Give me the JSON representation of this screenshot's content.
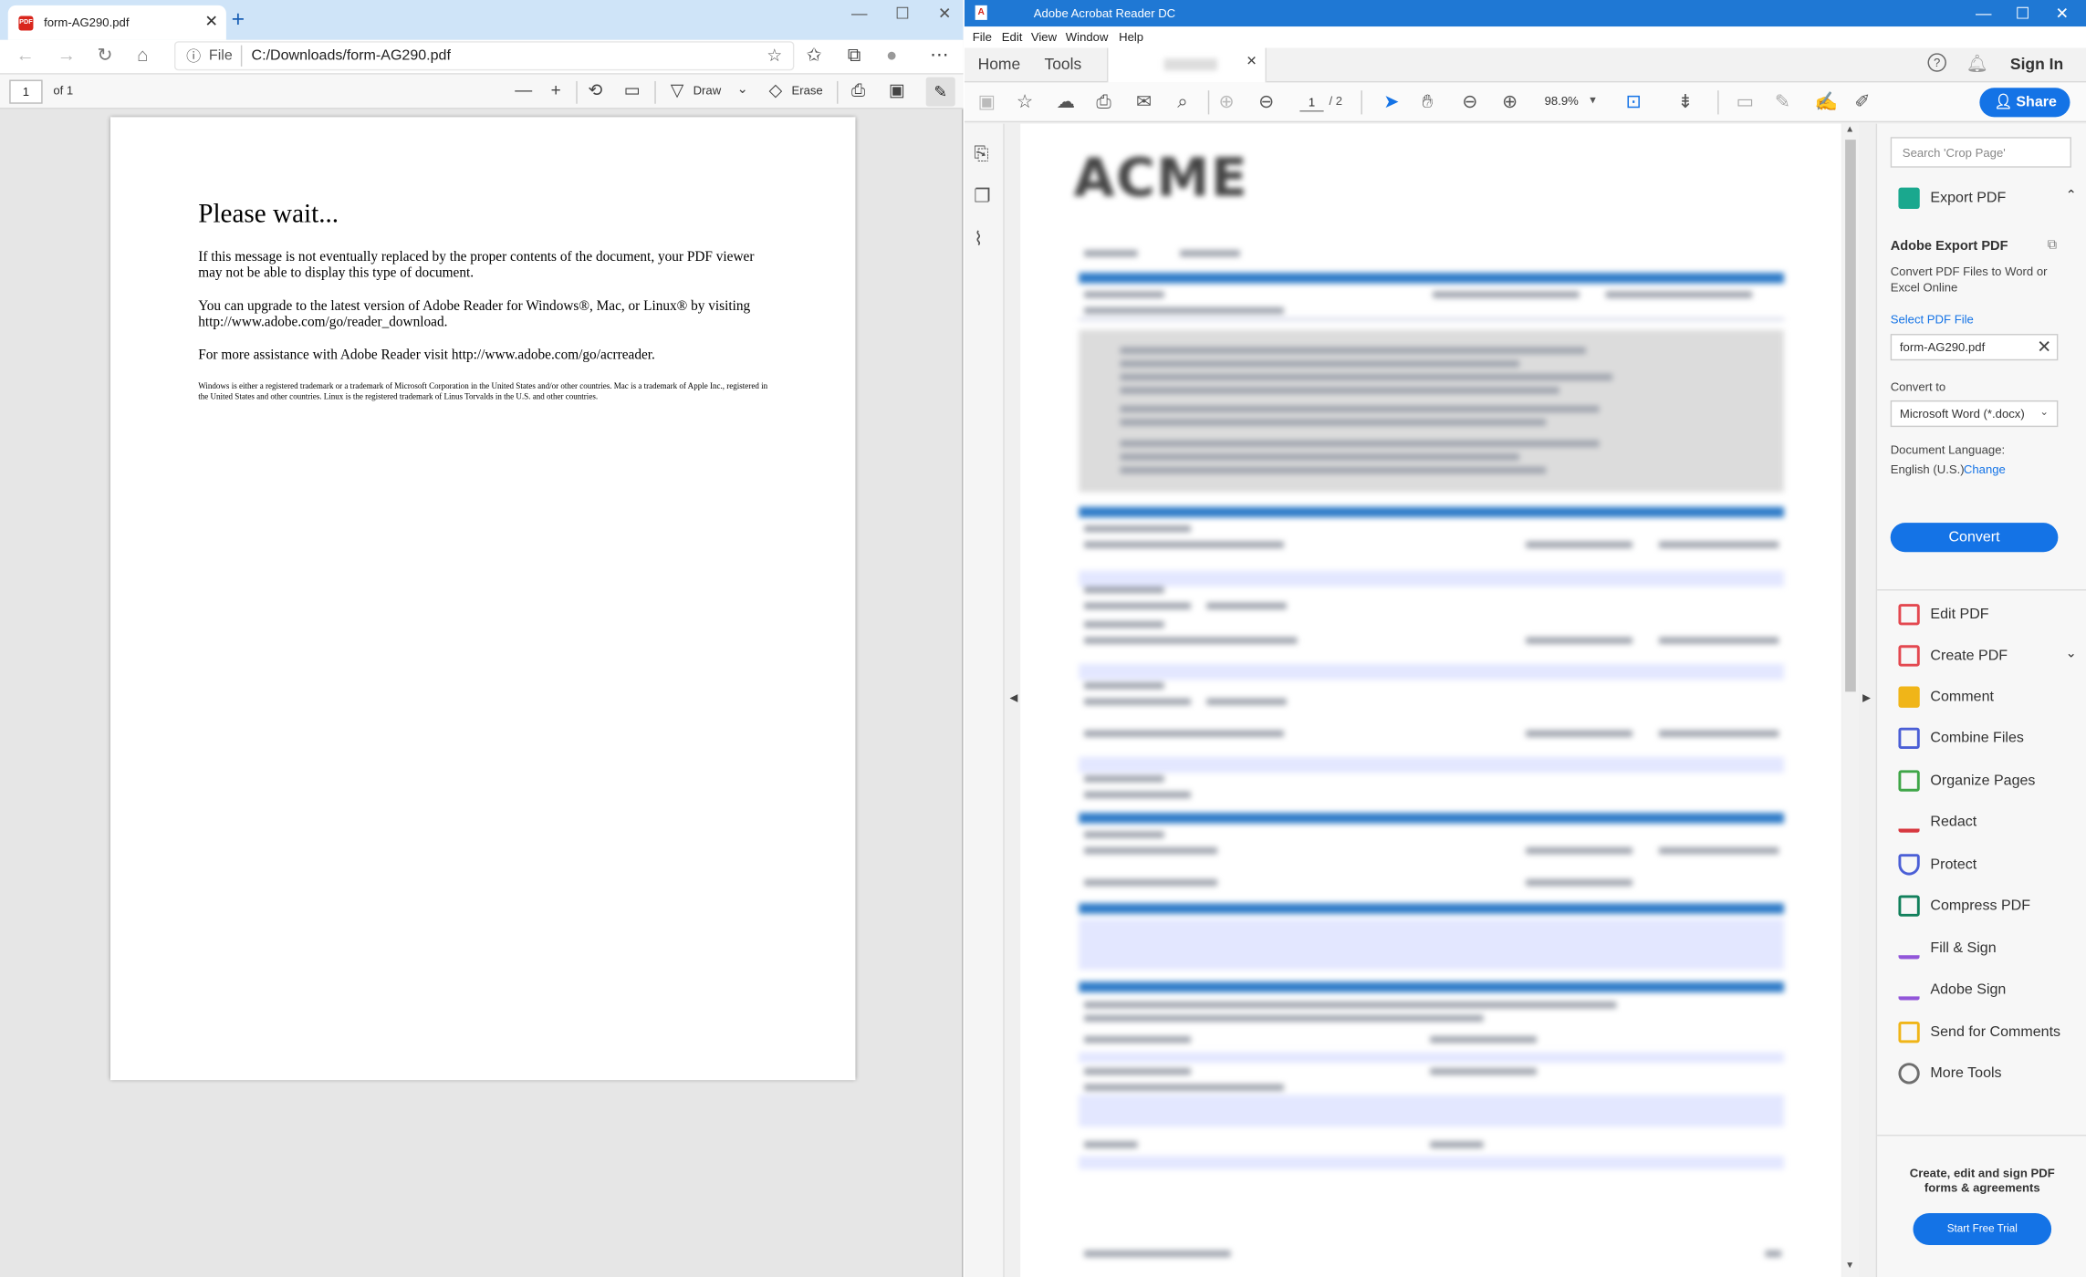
{
  "edge": {
    "tab_title": "form-AG290.pdf",
    "tab_icon": "pdf-file-icon",
    "address_prefix": "File",
    "address_url": "C:/Downloads/form-AG290.pdf",
    "page_number": "1",
    "page_of": "of 1",
    "draw_label": "Draw",
    "erase_label": "Erase"
  },
  "pdf_page": {
    "heading": "Please wait...",
    "para1": "If this message is not eventually replaced by the proper contents of the document, your PDF viewer may not be able to display this type of document.",
    "para2": "You can upgrade to the latest version of Adobe Reader for Windows®, Mac, or Linux® by visiting  http://www.adobe.com/go/reader_download.",
    "para3": "For more assistance with Adobe Reader visit  http://www.adobe.com/go/acrreader.",
    "legal": "Windows is either a registered trademark or a trademark of Microsoft Corporation in the United States and/or other countries. Mac is a trademark of Apple Inc., registered in the United States and other countries. Linux is the registered trademark of Linus Torvalds in the U.S. and other countries."
  },
  "acrobat": {
    "window_title": "Adobe Acrobat Reader DC",
    "menu": [
      "File",
      "Edit",
      "View",
      "Window",
      "Help"
    ],
    "tabs": {
      "home": "Home",
      "tools": "Tools"
    },
    "sign_in": "Sign In",
    "page_current": "1",
    "page_total": "/ 2",
    "zoom": "98.9%",
    "share_label": "Share",
    "document_logo_text": "ACME",
    "panel": {
      "search_placeholder": "Search 'Crop Page'",
      "export_header": "Export PDF",
      "export_title": "Adobe Export PDF",
      "export_desc": "Convert PDF Files to Word or Excel Online",
      "select_file": "Select PDF File",
      "file_name": "form-AG290.pdf",
      "convert_to_label": "Convert to",
      "convert_to_value": "Microsoft Word (*.docx)",
      "language_label": "Document Language:",
      "language_value": "English (U.S.)",
      "change_link": "Change",
      "convert_button": "Convert",
      "tools": [
        {
          "label": "Edit PDF",
          "icon": "edit-pdf-icon",
          "color": "#e34850"
        },
        {
          "label": "Create PDF",
          "icon": "create-pdf-icon",
          "color": "#e34850"
        },
        {
          "label": "Comment",
          "icon": "comment-icon",
          "color": "#f0b518"
        },
        {
          "label": "Combine Files",
          "icon": "combine-files-icon",
          "color": "#4b5fd6"
        },
        {
          "label": "Organize Pages",
          "icon": "organize-pages-icon",
          "color": "#3fa648"
        },
        {
          "label": "Redact",
          "icon": "redact-icon",
          "color": "#d7373f"
        },
        {
          "label": "Protect",
          "icon": "protect-icon",
          "color": "#4b5fd6"
        },
        {
          "label": "Compress PDF",
          "icon": "compress-pdf-icon",
          "color": "#12805c"
        },
        {
          "label": "Fill & Sign",
          "icon": "fill-sign-icon",
          "color": "#9256d9"
        },
        {
          "label": "Adobe Sign",
          "icon": "adobe-sign-icon",
          "color": "#9256d9"
        },
        {
          "label": "Send for Comments",
          "icon": "send-for-comments-icon",
          "color": "#f0b518"
        },
        {
          "label": "More Tools",
          "icon": "more-tools-icon",
          "color": "#6e6e6e"
        }
      ],
      "promo_text": "Create, edit and sign PDF forms & agreements",
      "trial_button": "Start Free Trial"
    }
  }
}
